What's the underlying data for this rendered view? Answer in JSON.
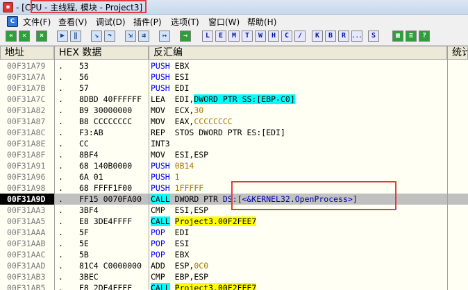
{
  "window": {
    "title_prefix": "- [CPU - ",
    "title_highlight": "主线程, 模块 - Project3]"
  },
  "menu": [
    "文件(F)",
    "查看(V)",
    "调试(D)",
    "插件(P)",
    "选项(T)",
    "窗口(W)",
    "帮助(H)"
  ],
  "toolbar": {
    "letters": [
      "L",
      "E",
      "M",
      "T",
      "W",
      "H",
      "C",
      "/",
      "K",
      "B",
      "R",
      "...",
      "S"
    ]
  },
  "headers": {
    "addr": "地址",
    "hex": "HEX 数据",
    "asm": "反汇编",
    "comment": "统计"
  },
  "rows": [
    {
      "addr": "00F31A79",
      "dot": ".",
      "hex": "53",
      "m": "PUSH",
      "op": "EBX"
    },
    {
      "addr": "00F31A7A",
      "dot": ".",
      "hex": "56",
      "m": "PUSH",
      "op": "ESI"
    },
    {
      "addr": "00F31A7B",
      "dot": ".",
      "hex": "57",
      "m": "PUSH",
      "op": "EDI"
    },
    {
      "addr": "00F31A7C",
      "dot": ".",
      "hex": "8DBD 40FFFFFF",
      "m": "LEA",
      "op": "EDI,",
      "op2": "DWORD PTR SS:[EBP-C0]"
    },
    {
      "addr": "00F31A82",
      "dot": ".",
      "hex": "B9 30000000",
      "m": "MOV",
      "op": "ECX,",
      "op2": "30"
    },
    {
      "addr": "00F31A87",
      "dot": ".",
      "hex": "B8 CCCCCCCC",
      "m": "MOV",
      "op": "EAX,",
      "op2": "CCCCCCCC"
    },
    {
      "addr": "00F31A8C",
      "dot": ".",
      "hex": "F3:AB",
      "m": "REP",
      "op": "STOS DWORD PTR ES:[EDI]"
    },
    {
      "addr": "00F31A8E",
      "dot": ".",
      "hex": "CC",
      "m": "INT3",
      "op": ""
    },
    {
      "addr": "00F31A8F",
      "dot": ".",
      "hex": "8BF4",
      "m": "MOV",
      "op": "ESI,ESP"
    },
    {
      "addr": "00F31A91",
      "dot": ".",
      "hex": "68 140B0000",
      "m": "PUSH",
      "op": "0B14"
    },
    {
      "addr": "00F31A96",
      "dot": ".",
      "hex": "6A 01",
      "m": "PUSH",
      "op": "1"
    },
    {
      "addr": "00F31A98",
      "dot": ".",
      "hex": "68 FFFF1F00",
      "m": "PUSH",
      "op": "1FFFFF"
    },
    {
      "addr": "00F31A9D",
      "dot": ".",
      "hex": "FF15 0070FA00",
      "m": "CALL",
      "op": "DWORD PTR ",
      "op2": "DS:[<&KERNEL32.OpenProcess>]"
    },
    {
      "addr": "00F31AA3",
      "dot": ".",
      "hex": "3BF4",
      "m": "CMP",
      "op": "ESI,ESP"
    },
    {
      "addr": "00F31AA5",
      "dot": ".",
      "hex": "E8 3DE4FFFF",
      "m": "CALL",
      "op": "Project3.00F2FEE7"
    },
    {
      "addr": "00F31AAA",
      "dot": ".",
      "hex": "5F",
      "m": "POP",
      "op": "EDI"
    },
    {
      "addr": "00F31AAB",
      "dot": ".",
      "hex": "5E",
      "m": "POP",
      "op": "ESI"
    },
    {
      "addr": "00F31AAC",
      "dot": ".",
      "hex": "5B",
      "m": "POP",
      "op": "EBX"
    },
    {
      "addr": "00F31AAD",
      "dot": ".",
      "hex": "81C4 C0000000",
      "m": "ADD",
      "op": "ESP,",
      "op2": "0C0"
    },
    {
      "addr": "00F31AB3",
      "dot": ".",
      "hex": "3BEC",
      "m": "CMP",
      "op": "EBP,ESP"
    },
    {
      "addr": "00F31AB5",
      "dot": ".",
      "hex": "E8 2DE4FFFF",
      "m": "CALL",
      "op": "Project3.00F2FEE7"
    }
  ],
  "selected_addr": "00F31A9D"
}
